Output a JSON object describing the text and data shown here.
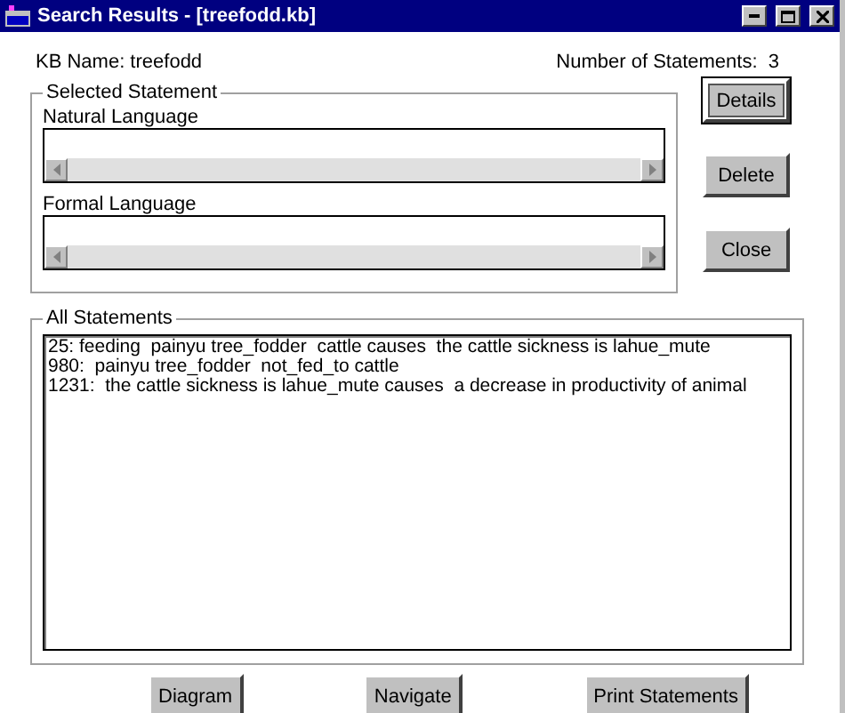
{
  "window": {
    "title": "Search Results - [treefodd.kb]"
  },
  "kb_name": "KB Name: treefodd",
  "statement_count": "Number of Statements:  3",
  "selected_statement": {
    "title": "Selected Statement",
    "fields": [
      {
        "label": "Natural Language"
      },
      {
        "label": "Formal Language"
      }
    ]
  },
  "side_buttons": [
    {
      "label": "Details",
      "focused": true
    },
    {
      "label": "Delete",
      "focused": false
    },
    {
      "label": "Close",
      "focused": false
    }
  ],
  "all_statements": {
    "title": "All Statements",
    "rows": [
      "25: feeding  painyu tree_fodder  cattle causes  the cattle sickness is lahue_mute",
      "980:  painyu tree_fodder  not_fed_to cattle",
      "1231:  the cattle sickness is lahue_mute causes  a decrease in productivity of animal"
    ]
  },
  "bottom_buttons": [
    "Diagram",
    "Navigate",
    "Print Statements"
  ]
}
